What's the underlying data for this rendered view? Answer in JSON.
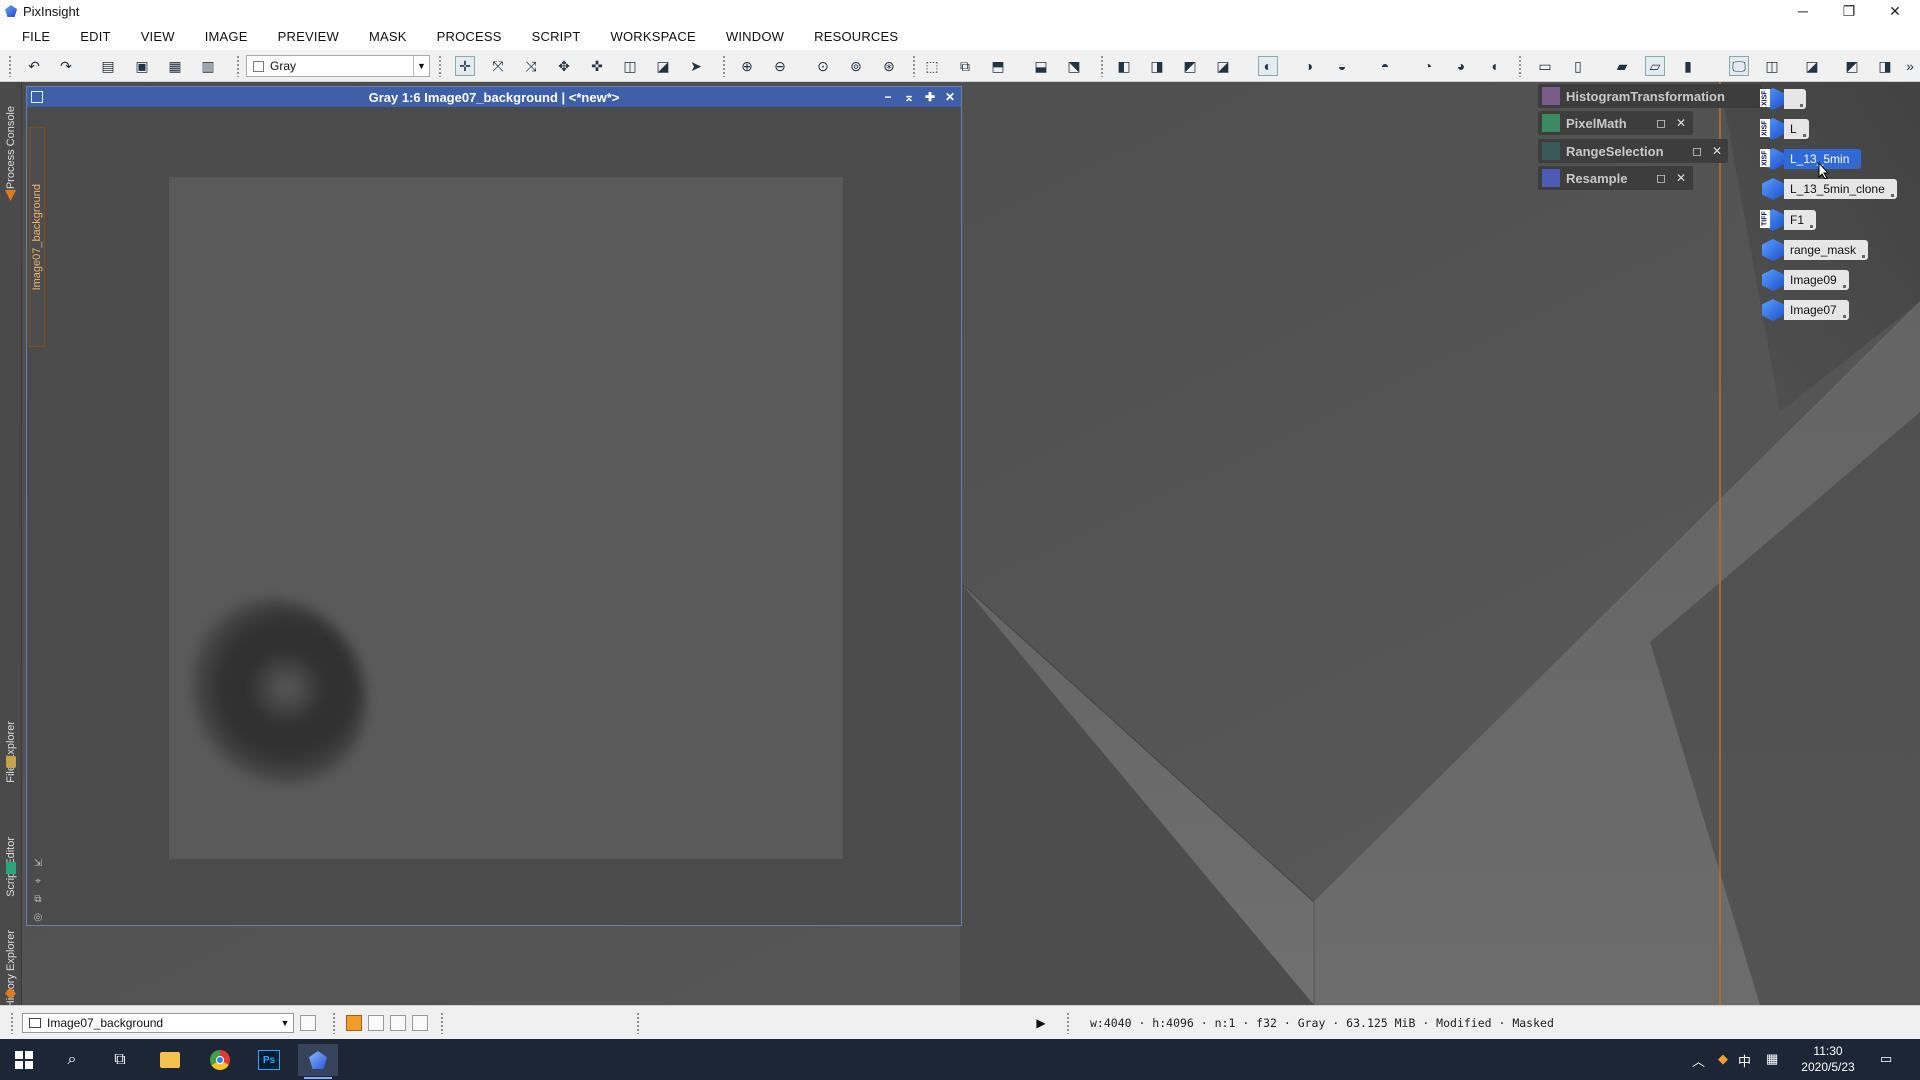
{
  "app": {
    "title": "PixInsight",
    "window_controls": [
      "─",
      "❐",
      "✕"
    ]
  },
  "menu": [
    "FILE",
    "EDIT",
    "VIEW",
    "IMAGE",
    "PREVIEW",
    "MASK",
    "PROCESS",
    "SCRIPT",
    "WORKSPACE",
    "WINDOW",
    "RESOURCES"
  ],
  "toolbar": {
    "color_mode": "Gray"
  },
  "left_panels": {
    "process_console": "Process Console",
    "file_explorer": "File Explorer",
    "script_editor": "Script Editor",
    "history_explorer": "History Explorer"
  },
  "image_window": {
    "title": "Gray 1:6 Image07_background | <*new*>",
    "view_label": "Image07_background",
    "controls": [
      "−",
      "⌅",
      "✚",
      "✕"
    ]
  },
  "process_icons": [
    {
      "label": "HistogramTransformation",
      "color": "#7a5a8a"
    },
    {
      "label": "PixelMath",
      "color": "#3c8a64"
    },
    {
      "label": "RangeSelection",
      "color": "#3a5a5a"
    },
    {
      "label": "Resample",
      "color": "#4d5ab8"
    }
  ],
  "view_icons": [
    {
      "label": "",
      "badge": "XISF"
    },
    {
      "label": "L",
      "badge": "XISF"
    },
    {
      "label": "L_13_5min",
      "badge": "XISF",
      "selected": true
    },
    {
      "label": "L_13_5min_clone"
    },
    {
      "label": "F1",
      "badge": "TIFF"
    },
    {
      "label": "range_mask"
    },
    {
      "label": "Image09"
    },
    {
      "label": "Image07"
    }
  ],
  "statusbar": {
    "view_select": "Image07_background",
    "info": "w:4040 · h:4096 · n:1 · f32 · Gray · 63.125 MiB · Modified · Masked"
  },
  "taskbar": {
    "time": "11:30",
    "date": "2020/5/23",
    "ime": "中"
  }
}
